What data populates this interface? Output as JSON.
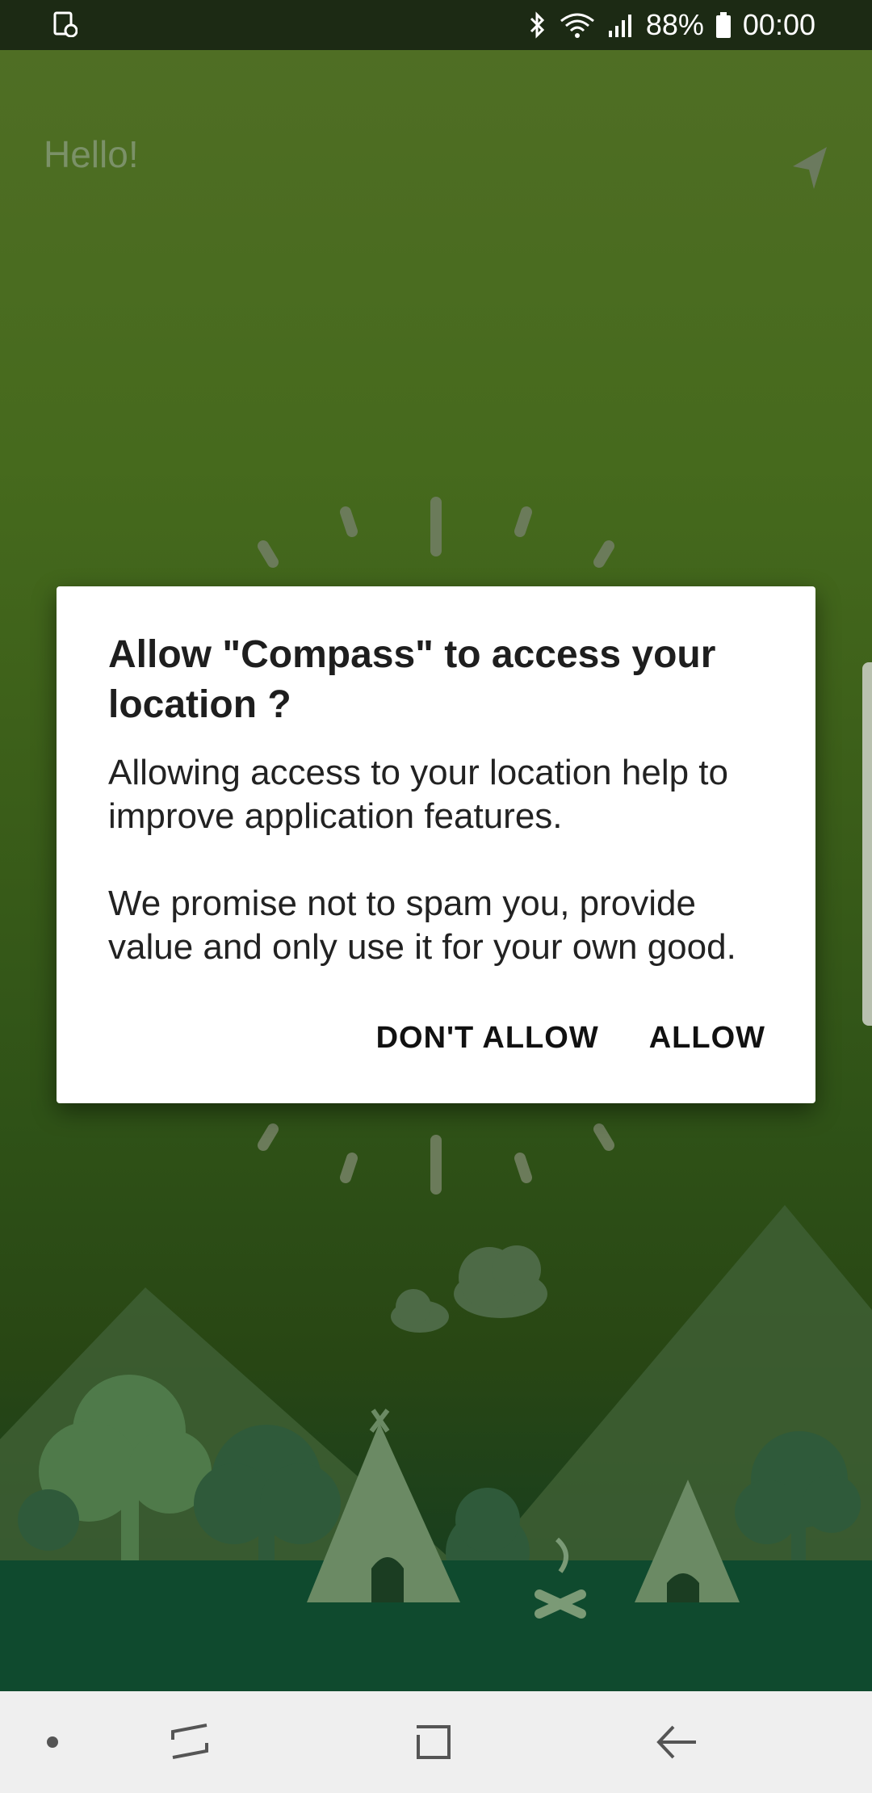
{
  "status_bar": {
    "battery_percent": "88%",
    "time": "00:00",
    "icons": [
      "screen-record-icon",
      "bluetooth-icon",
      "wifi-icon",
      "signal-icon",
      "battery-icon"
    ]
  },
  "app": {
    "greeting": "Hello!",
    "nav_icon": "navigation-arrow-icon"
  },
  "dialog": {
    "title": "Allow \"Compass\" to access your location ?",
    "body_paragraph_1": "Allowing access to your location help to improve application features.",
    "body_paragraph_2": "We promise not to spam you, provide value and only use it for your own good.",
    "deny_label": "DON'T ALLOW",
    "allow_label": "ALLOW"
  },
  "nav_bar": {
    "items": [
      "dot-icon",
      "recents-icon",
      "home-icon",
      "back-icon"
    ]
  },
  "colors": {
    "status_bar_bg": "#1c2a14",
    "background_top": "#4f6e24",
    "background_bottom": "#0f3a24",
    "dialog_bg": "#ffffff",
    "nav_bar_bg": "#efefef"
  }
}
